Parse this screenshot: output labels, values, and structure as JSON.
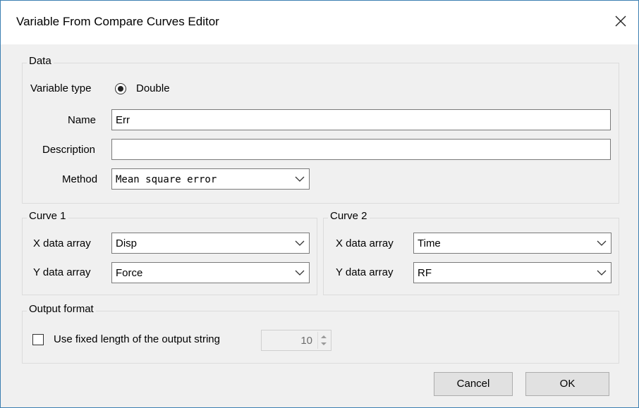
{
  "window": {
    "title": "Variable From Compare Curves Editor"
  },
  "data_group": {
    "title": "Data",
    "variable_type_label": "Variable type",
    "variable_type_option": "Double",
    "name_label": "Name",
    "name_value": "Err",
    "description_label": "Description",
    "description_value": "",
    "method_label": "Method",
    "method_value": "Mean square error"
  },
  "curve1": {
    "title": "Curve 1",
    "x_label": "X data array",
    "x_value": "Disp",
    "y_label": "Y data array",
    "y_value": "Force"
  },
  "curve2": {
    "title": "Curve 2",
    "x_label": "X data array",
    "x_value": "Time",
    "y_label": "Y data array",
    "y_value": "RF"
  },
  "output_format": {
    "title": "Output format",
    "checkbox_label": "Use fixed length of the output string",
    "length_value": "10"
  },
  "buttons": {
    "cancel": "Cancel",
    "ok": "OK"
  }
}
